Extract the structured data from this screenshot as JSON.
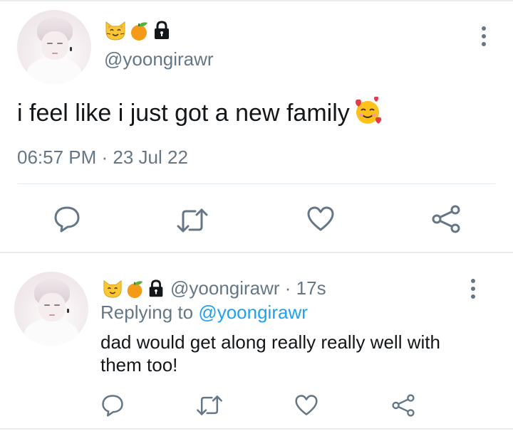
{
  "main_tweet": {
    "avatar_alt": "profile-photo",
    "name_emojis": [
      "cat-face",
      "tangerine",
      "locked"
    ],
    "handle": "@yoongirawr",
    "text": "i feel like i just got a new family",
    "text_emoji": "smiling-face-with-hearts",
    "timestamp": "06:57 PM · 23 Jul 22",
    "actions": [
      "reply-icon",
      "retweet-icon",
      "like-icon",
      "share-icon"
    ]
  },
  "reply_tweet": {
    "name_emojis": [
      "cat-face",
      "tangerine",
      "locked"
    ],
    "handle": "@yoongirawr",
    "separator": " · ",
    "age": "17s",
    "replying_prefix": "Replying to ",
    "replying_to": "@yoongirawr",
    "text": "dad would get along really really well with them too!",
    "actions": [
      "reply-icon",
      "retweet-icon",
      "like-icon",
      "share-icon"
    ]
  },
  "colors": {
    "secondary_text": "#657786",
    "link": "#1da1f2",
    "primary_text": "#14171a",
    "divider": "#e1e8ed"
  }
}
